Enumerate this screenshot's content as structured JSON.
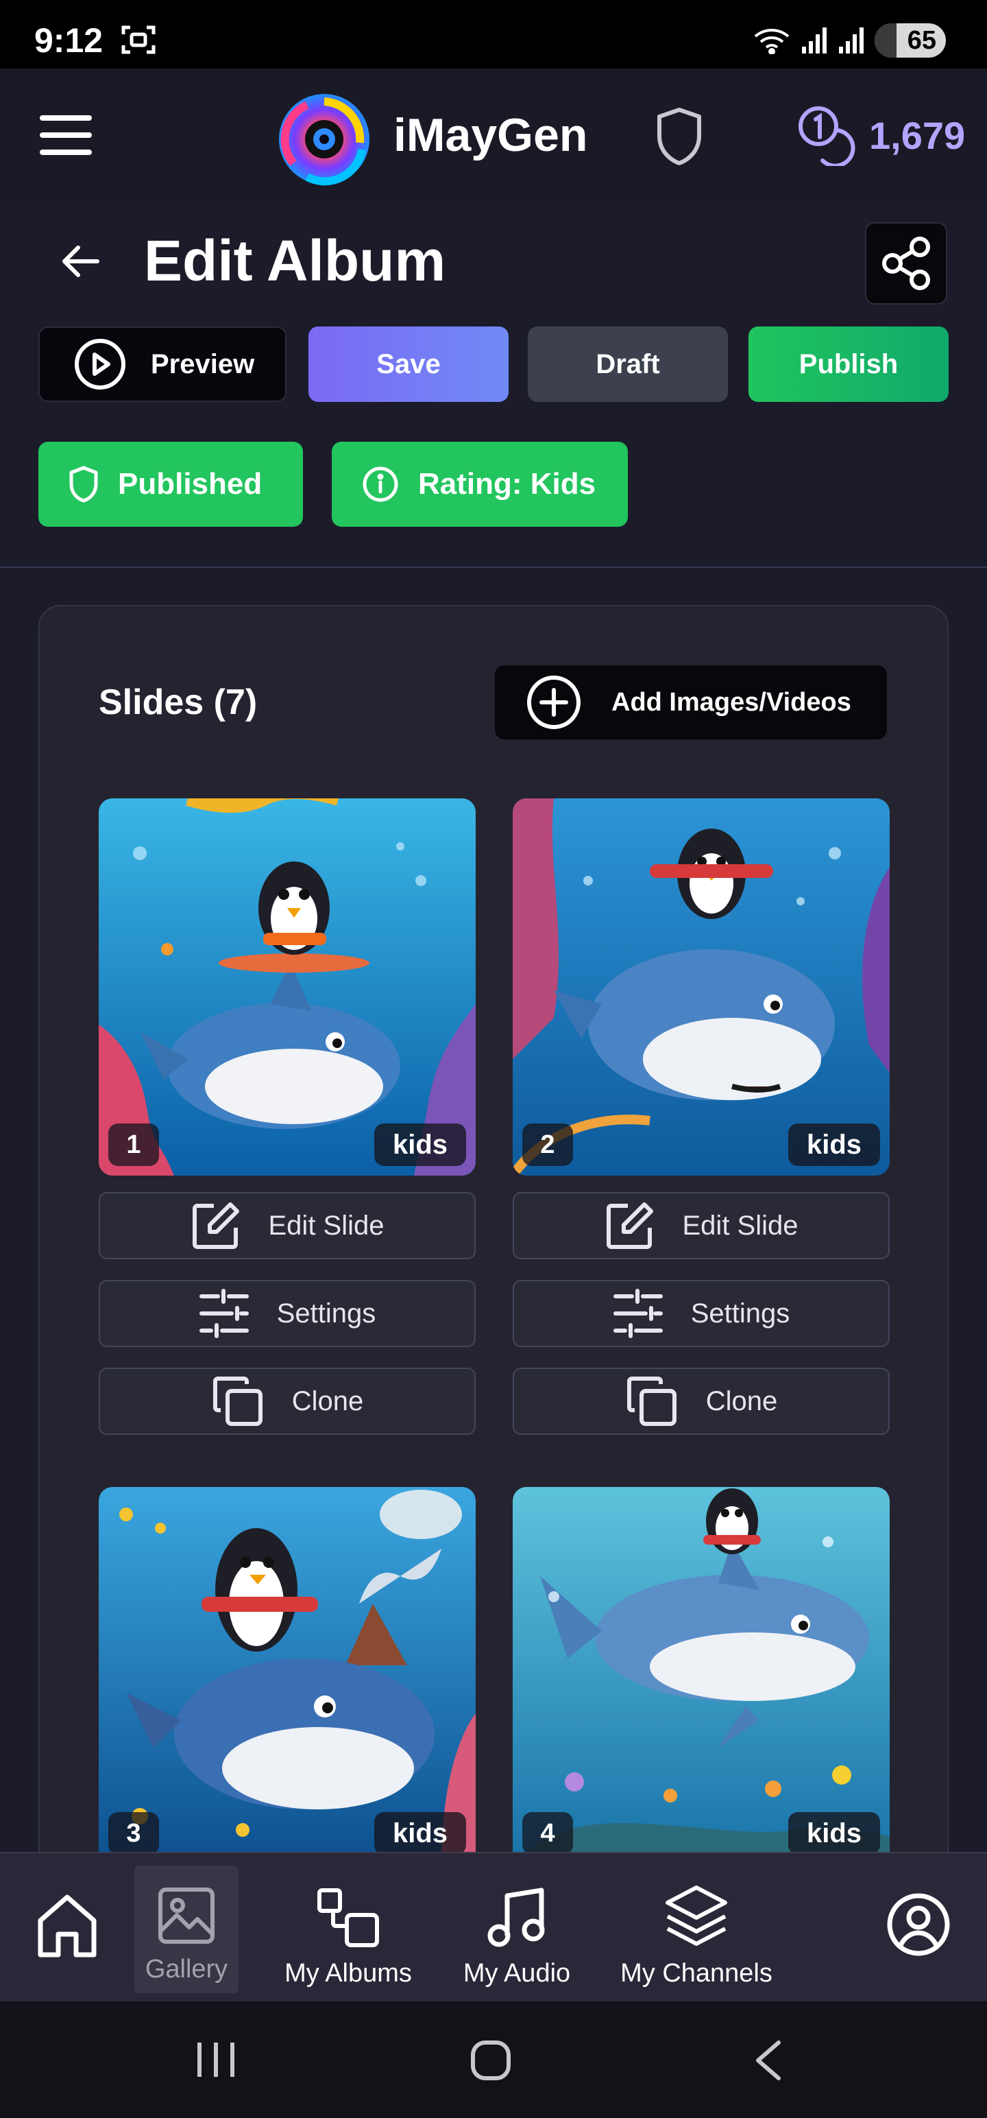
{
  "status_bar": {
    "time": "9:12",
    "battery": "65"
  },
  "header": {
    "brand": "iMayGen",
    "credits": "1,679"
  },
  "page": {
    "title": "Edit Album"
  },
  "actions": {
    "preview": "Preview",
    "save": "Save",
    "draft": "Draft",
    "publish": "Publish"
  },
  "badges": {
    "status": "Published",
    "rating": "Rating: Kids"
  },
  "slides": {
    "title": "Slides (7)",
    "add_label": "Add Images/Videos",
    "items": [
      {
        "number": "1",
        "tag": "kids"
      },
      {
        "number": "2",
        "tag": "kids"
      },
      {
        "number": "3",
        "tag": "kids"
      },
      {
        "number": "4",
        "tag": "kids"
      }
    ],
    "edit_label": "Edit Slide",
    "settings_label": "Settings",
    "clone_label": "Clone"
  },
  "bottom_nav": {
    "gallery": "Gallery",
    "albums": "My Albums",
    "audio": "My Audio",
    "channels": "My Channels"
  },
  "colors": {
    "background": "#1c1b29",
    "save": "#7c6af5",
    "publish": "#21c55d",
    "badge": "#22c55e",
    "credits": "#b4a4ff"
  },
  "icons": {
    "header": [
      "menu-icon",
      "logo",
      "shield-icon",
      "credits-icon"
    ],
    "page": [
      "back-arrow-icon",
      "share-icon",
      "play-circle-icon",
      "plus-circle-icon"
    ],
    "slide_buttons": [
      "edit-icon",
      "sliders-icon",
      "copy-icon"
    ],
    "nav": [
      "home-icon",
      "image-icon",
      "albums-icon",
      "music-note-icon",
      "layers-icon",
      "user-circle-icon"
    ]
  }
}
